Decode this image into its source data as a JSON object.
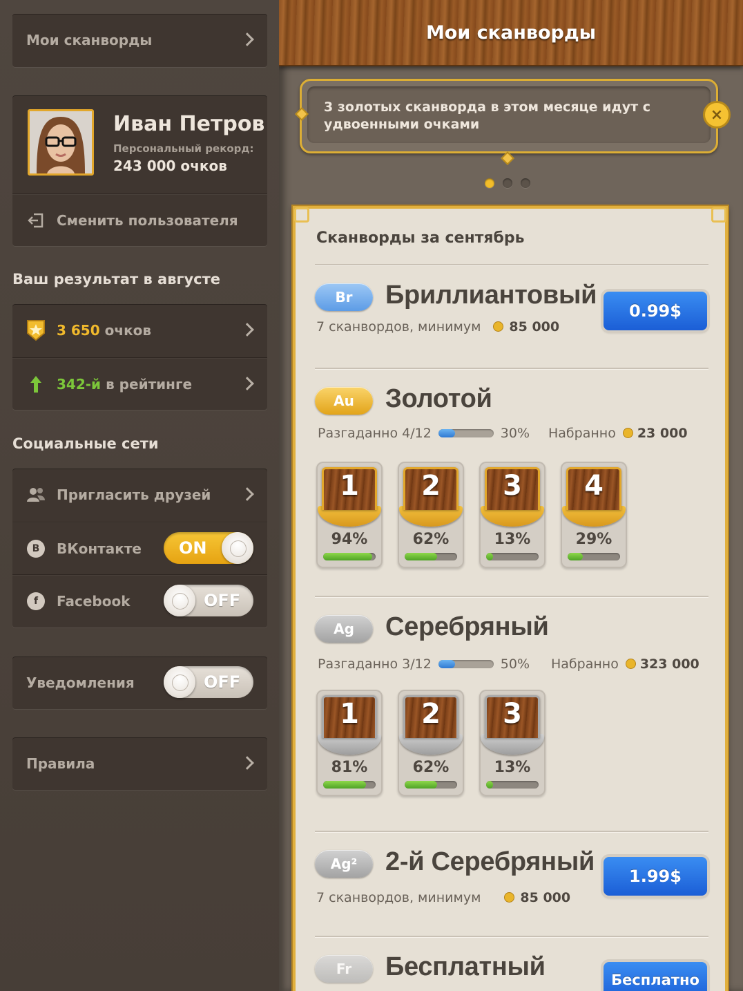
{
  "sidebar": {
    "my_scanwords": "Мои сканворды",
    "user": {
      "name": "Иван Петров",
      "record_label": "Персональный рекорд:",
      "record_value": "243 000 очков"
    },
    "switch_user": "Сменить пользователя",
    "august_heading": "Ваш результат в августе",
    "points": {
      "value": "3 650",
      "unit": "очков"
    },
    "rating": {
      "value": "342-й",
      "unit": "в рейтинге"
    },
    "social_heading": "Социальные сети",
    "invite": "Пригласить друзей",
    "vk": {
      "badge": "B",
      "label": "ВКонтакте",
      "state": "ON"
    },
    "facebook": {
      "badge": "f",
      "label": "Facebook",
      "state": "OFF"
    },
    "notifications": {
      "label": "Уведомления",
      "state": "OFF"
    },
    "rules": "Правила"
  },
  "main": {
    "title": "Мои сканворды",
    "banner": {
      "text": "3 золотых сканворда в этом месяце идут с удвоенными очками",
      "close": "×"
    },
    "pager_active": 0,
    "card_title": "Сканворды за сентябрь",
    "tiers": {
      "br": {
        "badge": "Br",
        "name": "Бриллиантовый",
        "sub": "7 сканвордов, минимум",
        "min": "85 000",
        "price": "0.99$"
      },
      "au": {
        "badge": "Au",
        "name": "Золотой",
        "solved_label": "Разгаданно",
        "solved": "4/12",
        "progress_pct": "30%",
        "progress": 0.3,
        "got_label": "Набранно",
        "got": "23 000",
        "tiles": [
          {
            "num": "1",
            "pct": "94%",
            "fill": 0.94
          },
          {
            "num": "2",
            "pct": "62%",
            "fill": 0.62
          },
          {
            "num": "3",
            "pct": "13%",
            "fill": 0.13
          },
          {
            "num": "4",
            "pct": "29%",
            "fill": 0.29
          }
        ]
      },
      "ag": {
        "badge": "Ag",
        "name": "Серебряный",
        "solved_label": "Разгаданно",
        "solved": "3/12",
        "progress_pct": "50%",
        "progress": 0.3,
        "got_label": "Набранно",
        "got": "323 000",
        "tiles": [
          {
            "num": "1",
            "pct": "81%",
            "fill": 0.81
          },
          {
            "num": "2",
            "pct": "62%",
            "fill": 0.62
          },
          {
            "num": "3",
            "pct": "13%",
            "fill": 0.13
          }
        ]
      },
      "ag2": {
        "badge": "Ag²",
        "name": "2-й Серебряный",
        "sub": "7 сканвордов, минимум",
        "min": "85 000",
        "price": "1.99$"
      },
      "fr": {
        "badge": "Fr",
        "name": "Бесплатный",
        "price": "Бесплатно"
      }
    }
  },
  "colors": {
    "accent_gold": "#e6a312",
    "button_blue": "#1b5ed6",
    "progress_green": "#4fa326",
    "positive_green": "#7cc63a"
  }
}
